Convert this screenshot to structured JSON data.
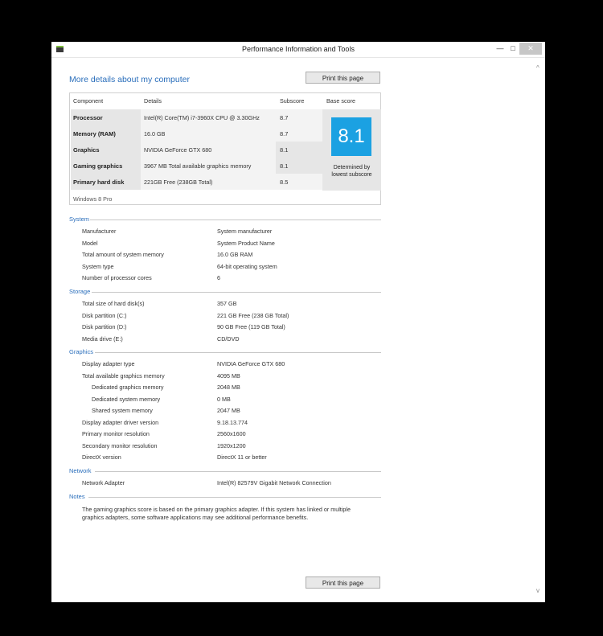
{
  "window": {
    "title": "Performance Information and Tools",
    "controls": {
      "minimize": "—",
      "maximize": "□",
      "close": "✕"
    }
  },
  "header": {
    "heading": "More details about my computer",
    "print_label": "Print this page"
  },
  "score_table": {
    "columns": [
      "Component",
      "Details",
      "Subscore",
      "Base score"
    ],
    "rows": [
      {
        "component": "Processor",
        "details": "Intel(R) Core(TM) i7-3960X CPU @ 3.30GHz",
        "subscore": "8.7"
      },
      {
        "component": "Memory (RAM)",
        "details": "16.0 GB",
        "subscore": "8.7"
      },
      {
        "component": "Graphics",
        "details": "NVIDIA GeForce GTX 680",
        "subscore": "8.1"
      },
      {
        "component": "Gaming graphics",
        "details": "3967 MB Total available graphics memory",
        "subscore": "8.1"
      },
      {
        "component": "Primary hard disk",
        "details": "221GB Free (238GB Total)",
        "subscore": "8.5"
      }
    ],
    "base_score": "8.1",
    "base_caption_1": "Determined by",
    "base_caption_2": "lowest subscore",
    "os": "Windows 8 Pro"
  },
  "sections": {
    "system": {
      "title": "System",
      "items": [
        {
          "label": "Manufacturer",
          "value": "System manufacturer"
        },
        {
          "label": "Model",
          "value": "System Product Name"
        },
        {
          "label": "Total amount of system memory",
          "value": "16.0 GB RAM"
        },
        {
          "label": "System type",
          "value": "64-bit operating system"
        },
        {
          "label": "Number of processor cores",
          "value": "6"
        }
      ]
    },
    "storage": {
      "title": "Storage",
      "items": [
        {
          "label": "Total size of hard disk(s)",
          "value": "357 GB"
        },
        {
          "label": "Disk partition (C:)",
          "value": "221 GB Free (238 GB Total)"
        },
        {
          "label": "Disk partition (D:)",
          "value": "90 GB Free (119 GB Total)"
        },
        {
          "label": "Media drive (E:)",
          "value": "CD/DVD"
        }
      ]
    },
    "graphics": {
      "title": "Graphics",
      "items": [
        {
          "label": "Display adapter type",
          "value": "NVIDIA GeForce GTX 680"
        },
        {
          "label": "Total available graphics memory",
          "value": "4095 MB"
        },
        {
          "label": "Dedicated graphics memory",
          "value": "2048 MB"
        },
        {
          "label": "Dedicated system memory",
          "value": "0 MB"
        },
        {
          "label": "Shared system memory",
          "value": "2047 MB"
        },
        {
          "label": "Display adapter driver version",
          "value": "9.18.13.774"
        },
        {
          "label": "Primary monitor resolution",
          "value": "2560x1600"
        },
        {
          "label": "Secondary monitor resolution",
          "value": "1920x1200"
        },
        {
          "label": "DirectX version",
          "value": "DirectX 11 or better"
        }
      ]
    },
    "network": {
      "title": "Network",
      "items": [
        {
          "label": "Network Adapter",
          "value": "Intel(R) 82579V Gigabit Network Connection"
        }
      ]
    },
    "notes": {
      "title": "Notes",
      "line1": "The gaming graphics score is based on the primary graphics adapter. If this system has linked or multiple",
      "line2": "graphics adapters, some software applications may see additional performance benefits."
    }
  }
}
